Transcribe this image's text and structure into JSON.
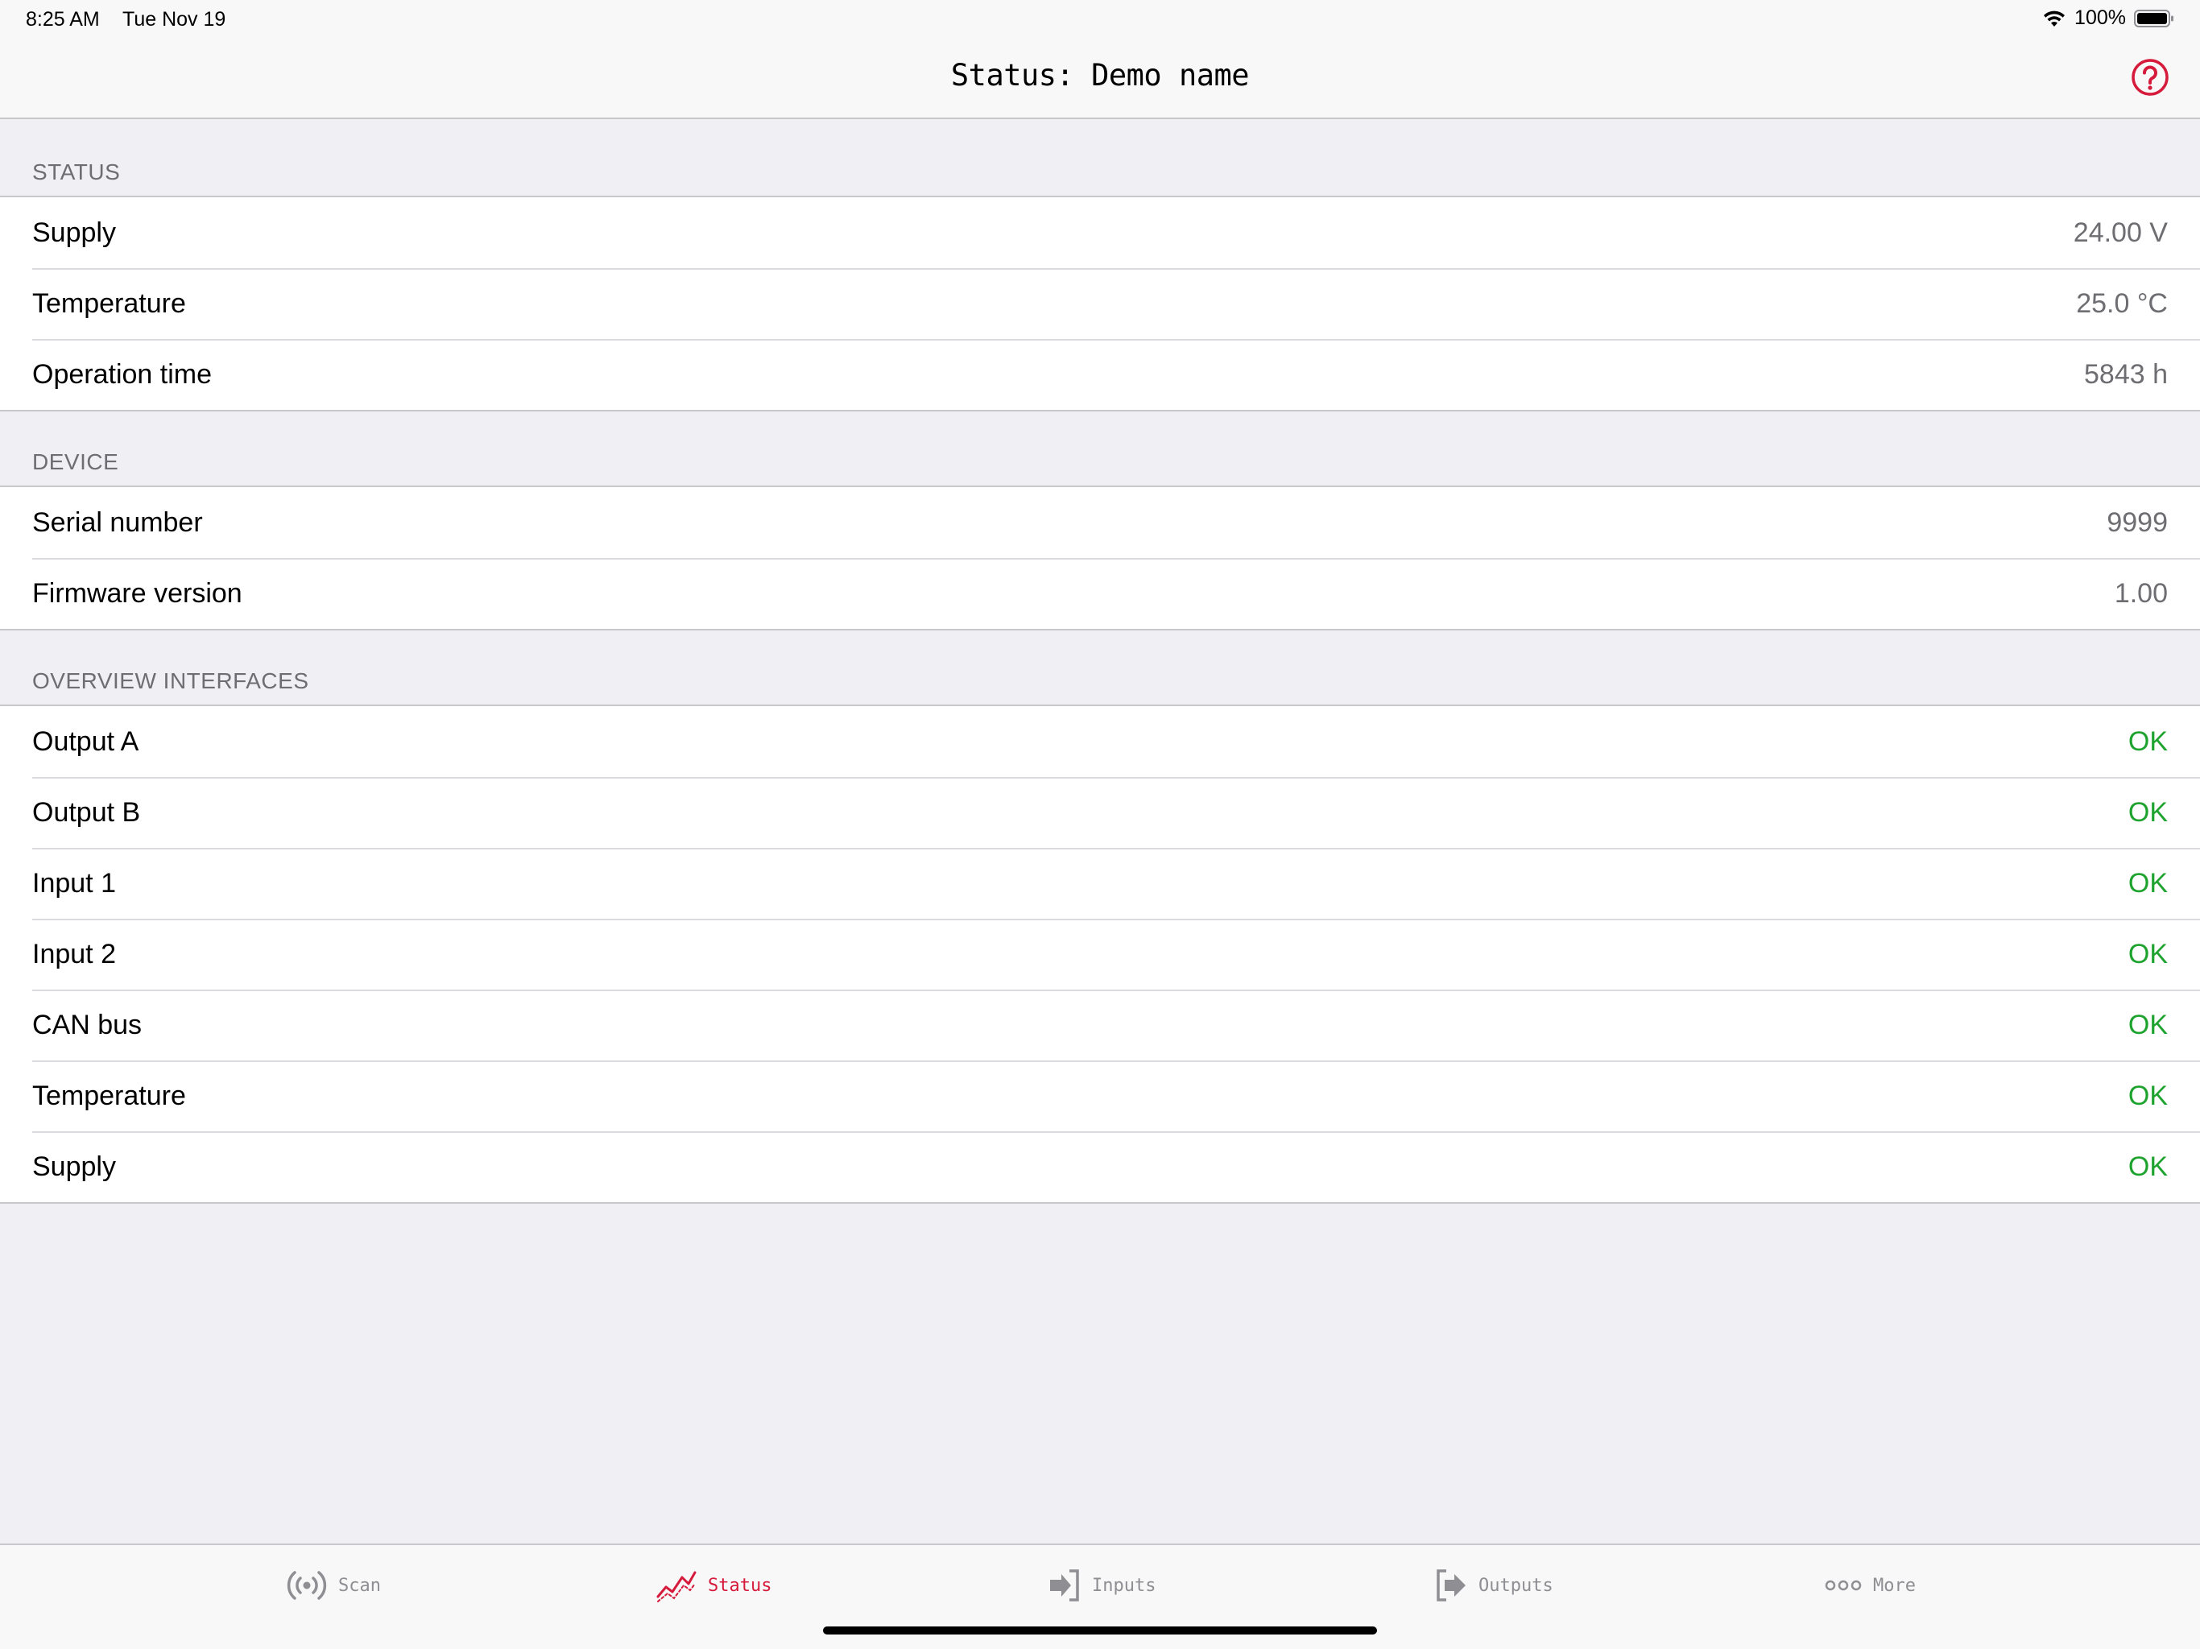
{
  "status_bar": {
    "time": "8:25 AM",
    "date": "Tue Nov 19",
    "battery_percent": "100%"
  },
  "nav": {
    "title": "Status: Demo name",
    "help_icon": "question-circle-icon"
  },
  "sections": {
    "status": {
      "header": "STATUS",
      "rows": [
        {
          "label": "Supply",
          "value": "24.00 V"
        },
        {
          "label": "Temperature",
          "value": "25.0 °C"
        },
        {
          "label": "Operation time",
          "value": "5843 h"
        }
      ]
    },
    "device": {
      "header": "DEVICE",
      "rows": [
        {
          "label": "Serial number",
          "value": "9999"
        },
        {
          "label": "Firmware version",
          "value": "1.00"
        }
      ]
    },
    "interfaces": {
      "header": "OVERVIEW INTERFACES",
      "rows": [
        {
          "label": "Output A",
          "value": "OK"
        },
        {
          "label": "Output B",
          "value": "OK"
        },
        {
          "label": "Input 1",
          "value": "OK"
        },
        {
          "label": "Input 2",
          "value": "OK"
        },
        {
          "label": "CAN bus",
          "value": "OK"
        },
        {
          "label": "Temperature",
          "value": "OK"
        },
        {
          "label": "Supply",
          "value": "OK"
        }
      ]
    }
  },
  "tabs": [
    {
      "label": "Scan",
      "icon": "broadcast-icon",
      "active": false
    },
    {
      "label": "Status",
      "icon": "line-chart-icon",
      "active": true
    },
    {
      "label": "Inputs",
      "icon": "sign-in-icon",
      "active": false
    },
    {
      "label": "Outputs",
      "icon": "sign-out-icon",
      "active": false
    },
    {
      "label": "More",
      "icon": "more-dots-icon",
      "active": false
    }
  ],
  "colors": {
    "accent": "#d51a3c",
    "ok": "#1fa32f",
    "background": "#efeff4"
  }
}
